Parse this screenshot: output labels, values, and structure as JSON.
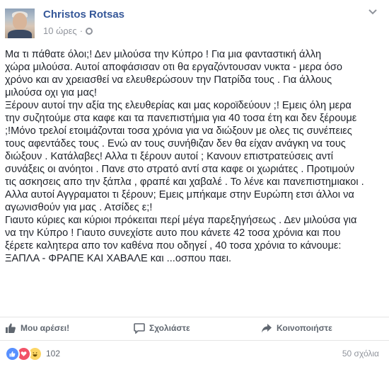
{
  "post": {
    "author": "Christos Rotsas",
    "time": "10 ώρες",
    "separator": "·",
    "body_lines": [
      "Μα τι πάθατε όλοι;! Δεν μιλούσα την Κύπρο ! Για μια φανταστική άλλη",
      "χώρα μιλούσα. Αυτοί αποφάσισαν οτι θα εργαζόντουσαν νυκτα - μερα όσο",
      "χρόνο και αν χρειασθεί να ελευθερώσουν την Πατρίδα τους . Για άλλους",
      "μιλούσα οχι για μας!",
      "Ξέρουν αυτοί την αξία της ελευθερίας και μας κοροϊδεύουν ;! Εμεις όλη μερα",
      "την συζητούμε στα καφε και τα πανεπιστήμια για 40 τοσα έτη και δεν ξέρουμε",
      ";!Μόνο τρελοί ετοιμάζονται τοσα χρόνια για να διώξουν με ολες τις συνέπειες",
      "τους αφεντάδες τους . Ενώ αν τους συνήθιζαν δεν θα είχαν ανάγκη να τους",
      "διώξουν . Κατάλαβες! Αλλα τι ξέρουν αυτοί ; Κανουν επιστρατεύσεις αντί",
      "συνάξεις οι ανόητοι . Πανε στο στρατό αντί στα καφε οι χωριάτες . Προτιμούν",
      "τις ασκησεις απο την ξάπλα , φραπέ και χαβαλέ . Το λένε και πανεπιστημιακοι .",
      "Αλλα αυτοί Αγγραματοι τι ξέρουν; Εμεις μπήκαμε στην Ευρώπη ετσι άλλοι να",
      "αγωνισθούν για μας . Ατσίδες ε;!",
      "Γιαυτο κύριες και κύριοι πρόκειται περί μέγα παρεξηγήσεως . Δεν μιλούσα για",
      "να την Κύπρο ! Γιαυτο συνεχίστε αυτο που κάνετε 42 τοσα χρόνια και που",
      "ξέρετε καλητερα απο τον καθένα που οδηγεί , 40 τοσα χρόνια το κάνουμε:",
      "ΞΑΠΛΑ - ΦΡΑΠΕ ΚΑΙ ΧΑΒΑΛΕ και ...οσπου παει."
    ]
  },
  "actions": {
    "like": "Μου αρέσει!",
    "comment": "Σχολιάστε",
    "share": "Κοινοποιήστε"
  },
  "reactions": {
    "count": "102",
    "comments": "50 σχόλια"
  },
  "colors": {
    "link": "#365899",
    "meta": "#90949c",
    "action": "#606770",
    "like": "#5890ff",
    "love": "#f25268",
    "haha": "#fcd665"
  }
}
